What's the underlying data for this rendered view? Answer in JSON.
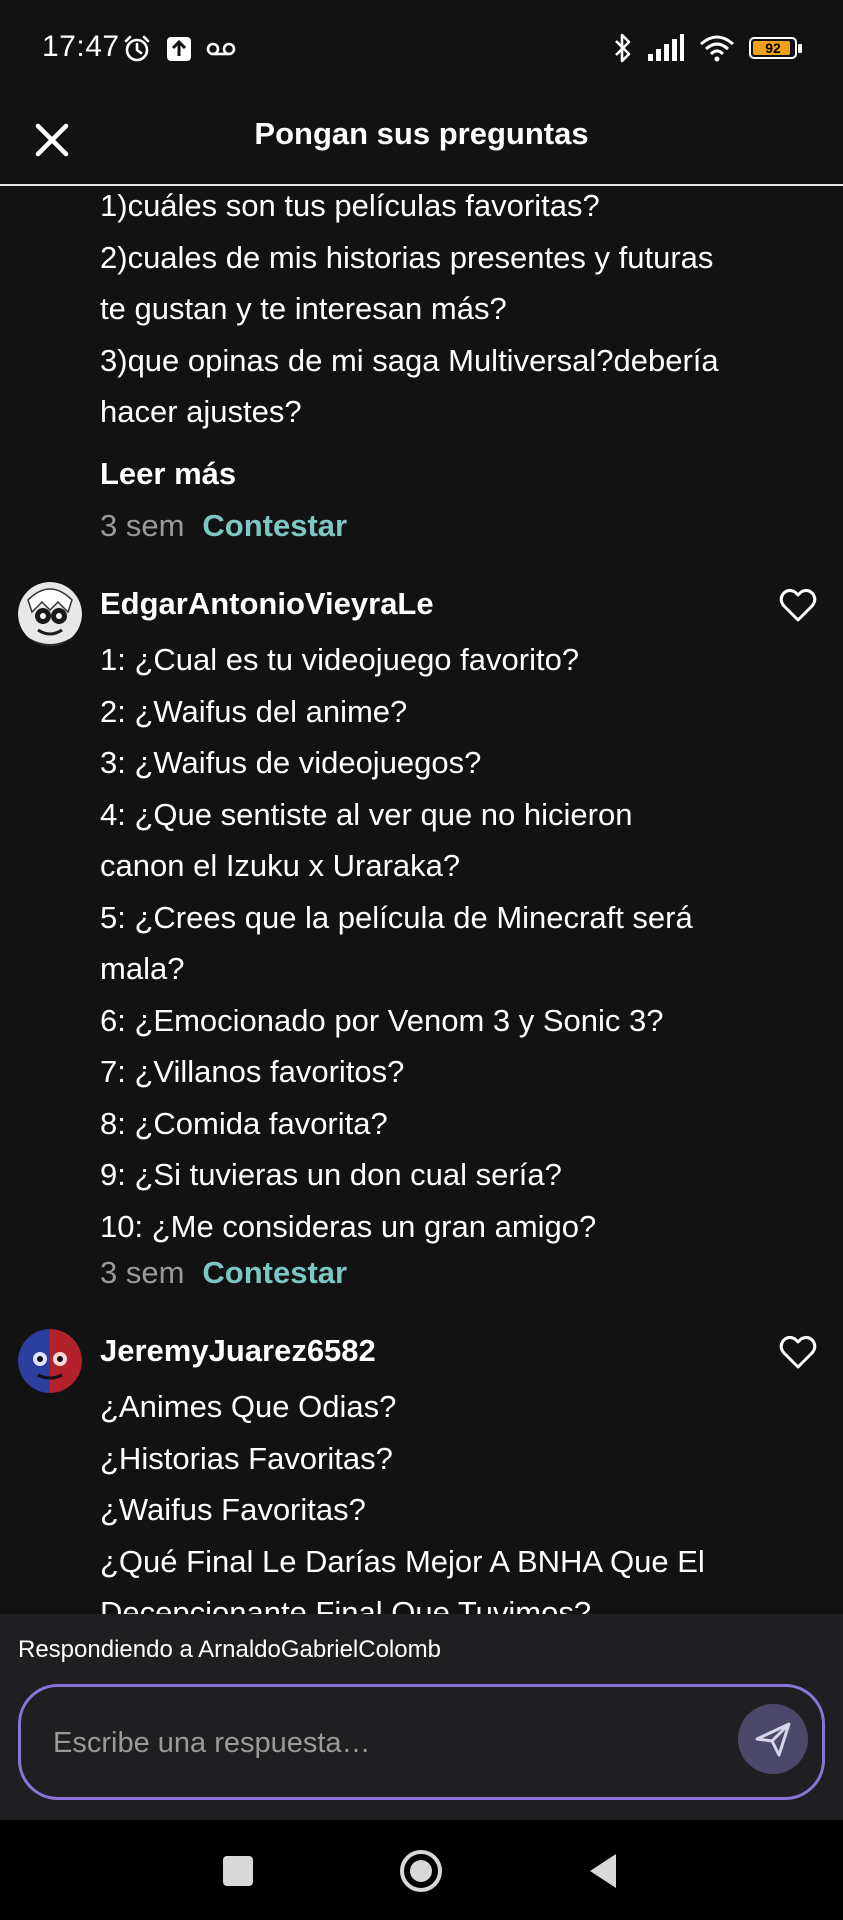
{
  "status_bar": {
    "time": "17:47",
    "battery": "92",
    "icons_left": [
      "alarm-icon",
      "upload-notification-icon",
      "voicemail-icon"
    ],
    "icons_right": [
      "bluetooth-icon",
      "signal-icon",
      "wifi-icon",
      "battery-icon"
    ]
  },
  "header": {
    "title": "Pongan sus preguntas",
    "close_icon": "close-icon"
  },
  "comments": [
    {
      "lines": [
        "1)cuáles son tus películas favoritas?",
        "2)cuales de mis historias presentes y futuras",
        "te gustan y te interesan más?",
        "3)que opinas de mi saga Multiversal?debería",
        "hacer ajustes?"
      ],
      "read_more": "Leer más",
      "time": "3 sem",
      "reply": "Contestar"
    },
    {
      "username": "EdgarAntonioVieyraLe",
      "lines": [
        "1: ¿Cual es tu videojuego favorito?",
        "2: ¿Waifus del anime?",
        "3: ¿Waifus de videojuegos?",
        "4: ¿Que sentiste al ver que no hicieron",
        "canon el Izuku x Uraraka?",
        "5: ¿Crees que la película de Minecraft será",
        "mala?",
        "6: ¿Emocionado por Venom 3 y Sonic 3?",
        "7: ¿Villanos favoritos?",
        "8: ¿Comida favorita?",
        "9: ¿Si tuvieras un don cual sería?",
        "10: ¿Me consideras un gran amigo?"
      ],
      "time": "3 sem",
      "reply": "Contestar"
    },
    {
      "username": "JeremyJuarez6582",
      "lines": [
        "¿Animes Que Odias?",
        "¿Historias Favoritas?",
        "¿Waifus Favoritas?",
        "¿Qué Final Le Darías Mejor A BNHA Que El",
        "Decepcionante Final Que Tuvimos?"
      ]
    }
  ],
  "reply_bar": {
    "replying_to": "Respondiendo a ArnaldoGabrielColomb",
    "placeholder": "Escribe una respuesta…",
    "send_icon": "send-icon",
    "accent": "#8a74d8"
  },
  "nav": [
    "recent-apps-icon",
    "home-icon",
    "back-icon"
  ],
  "colors": {
    "background": "#121212",
    "reply_link": "#7cc6c3",
    "muted": "#9a9a9a"
  }
}
